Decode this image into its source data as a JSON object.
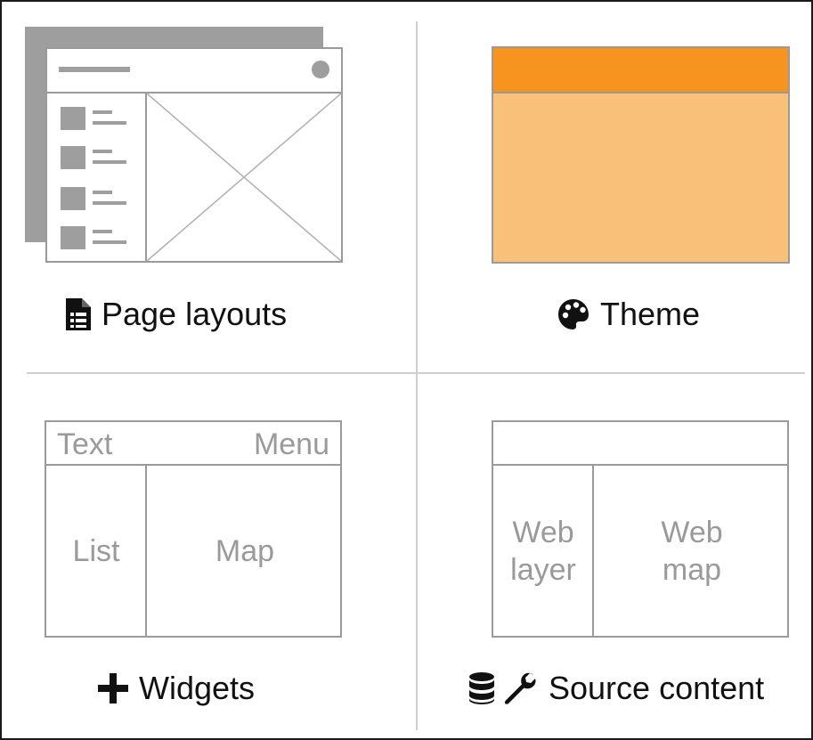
{
  "panels": {
    "page_layouts": {
      "caption": "Page layouts",
      "icon": "file-document-icon"
    },
    "theme": {
      "caption": "Theme",
      "icon": "palette-icon",
      "colors": {
        "header": "#F7941D",
        "body": "#F9C07A",
        "border": "#9a9a9a"
      }
    },
    "widgets": {
      "caption": "Widgets",
      "icon": "plus-icon",
      "header_left": "Text",
      "header_right": "Menu",
      "left_pane": "List",
      "main_pane": "Map"
    },
    "source_content": {
      "caption": "Source content",
      "icons": [
        "database-icon",
        "wrench-icon"
      ],
      "left_pane": "Web\nlayer",
      "main_pane": "Web\nmap"
    }
  }
}
